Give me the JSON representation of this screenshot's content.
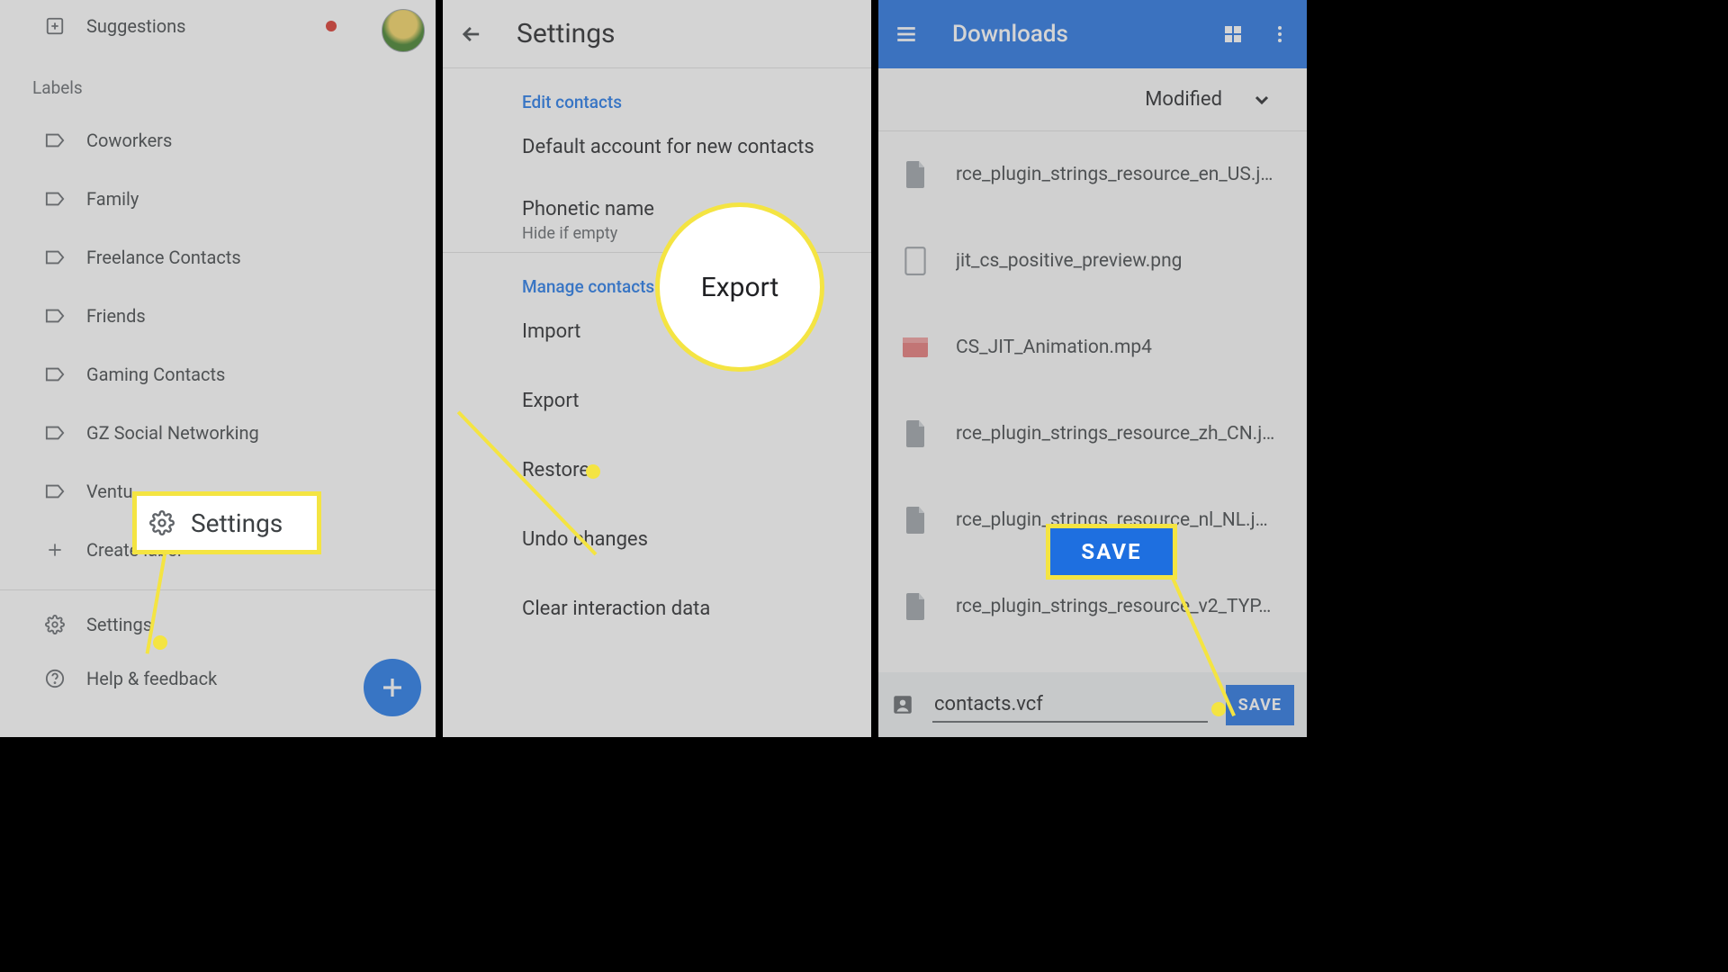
{
  "panel1": {
    "suggestions": "Suggestions",
    "labels_heading": "Labels",
    "labels": [
      "Coworkers",
      "Family",
      "Freelance Contacts",
      "Friends",
      "Gaming Contacts",
      "GZ Social Networking",
      "Ventu"
    ],
    "create_label": "Create label",
    "settings": "Settings",
    "help": "Help & feedback"
  },
  "callout1": {
    "text": "Settings"
  },
  "panel2": {
    "title": "Settings",
    "section_edit": "Edit contacts",
    "default_account": "Default account for new contacts",
    "phonetic": "Phonetic name",
    "phonetic_sub": "Hide if empty",
    "section_manage": "Manage contacts",
    "items": [
      "Import",
      "Export",
      "Restore",
      "Undo changes",
      "Clear interaction data"
    ]
  },
  "callout2": {
    "text": "Export"
  },
  "panel3": {
    "title": "Downloads",
    "sort": "Modified",
    "files": [
      {
        "name": "rce_plugin_strings_resource_en_US.j…",
        "kind": "doc"
      },
      {
        "name": "jit_cs_positive_preview.png",
        "kind": "img"
      },
      {
        "name": "CS_JIT_Animation.mp4",
        "kind": "vid"
      },
      {
        "name": "rce_plugin_strings_resource_zh_CN.j…",
        "kind": "doc"
      },
      {
        "name": "rce_plugin_strings_resource_nl_NL.j…",
        "kind": "doc"
      },
      {
        "name": "rce_plugin_strings_resource_v2_TYP…",
        "kind": "doc"
      }
    ],
    "filename": "contacts.vcf",
    "save": "SAVE"
  },
  "callout3": {
    "text": "SAVE"
  }
}
